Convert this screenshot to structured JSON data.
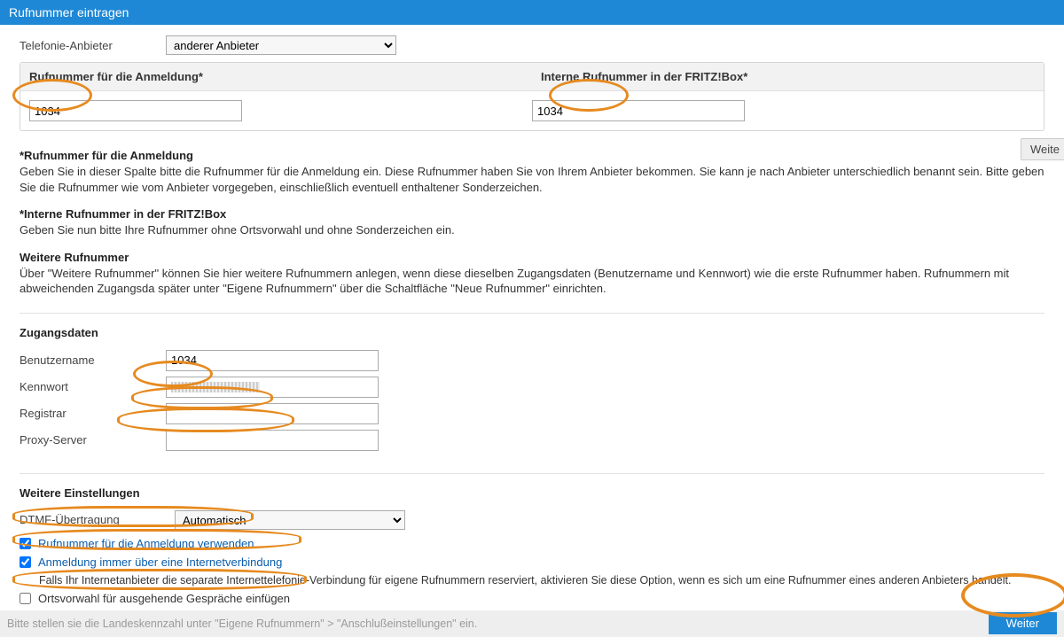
{
  "header": {
    "title": "Rufnummer eintragen"
  },
  "provider": {
    "label": "Telefonie-Anbieter",
    "selected": "anderer Anbieter"
  },
  "numbers": {
    "head_left": "Rufnummer für die Anmeldung*",
    "head_right": "Interne Rufnummer in der FRITZ!Box*",
    "left_value": "1034",
    "right_value": "1034"
  },
  "btn_weiter_top": "Weite",
  "help": {
    "h1": "*Rufnummer für die Anmeldung",
    "p1": "Geben Sie in dieser Spalte bitte die Rufnummer für die Anmeldung ein. Diese Rufnummer haben Sie von Ihrem Anbieter bekommen. Sie kann je nach Anbieter unterschiedlich benannt sein. Bitte geben Sie die Rufnummer wie vom Anbieter vorgegeben, einschließlich eventuell enthaltener Sonderzeichen.",
    "h2": "*Interne Rufnummer in der FRITZ!Box",
    "p2": "Geben Sie nun bitte Ihre Rufnummer ohne Ortsvorwahl und ohne Sonderzeichen ein.",
    "h3": "Weitere Rufnummer",
    "p3": "Über \"Weitere Rufnummer\" können Sie hier weitere Rufnummern anlegen, wenn diese dieselben Zugangsdaten (Benutzername und Kennwort) wie die erste Rufnummer haben. Rufnummern mit abweichenden Zugangsda später unter \"Eigene Rufnummern\" über die Schaltfläche \"Neue Rufnummer\" einrichten."
  },
  "creds": {
    "title": "Zugangsdaten",
    "user_label": "Benutzername",
    "user_value": "1034",
    "pass_label": "Kennwort",
    "reg_label": "Registrar",
    "proxy_label": "Proxy-Server"
  },
  "more": {
    "title": "Weitere Einstellungen",
    "dtmf_label": "DTMF-Übertragung",
    "dtmf_value": "Automatisch",
    "chk1": "Rufnummer für die Anmeldung verwenden",
    "chk2": "Anmeldung immer über eine Internetverbindung",
    "chk2_help": "Falls Ihr Internetanbieter die separate Internettelefonie-Verbindung für eigene Rufnummern reserviert, aktivieren Sie diese Option, wenn es sich um eine Rufnummer eines anderen Anbieters handelt.",
    "chk3": "Ortsvorwahl für ausgehende Gespräche einfügen"
  },
  "footer_hint": "Bitte stellen sie die Landeskennzahl unter \"Eigene Rufnummern\" > \"Anschlußeinstellungen\" ein.",
  "btn_weiter": "Weiter"
}
